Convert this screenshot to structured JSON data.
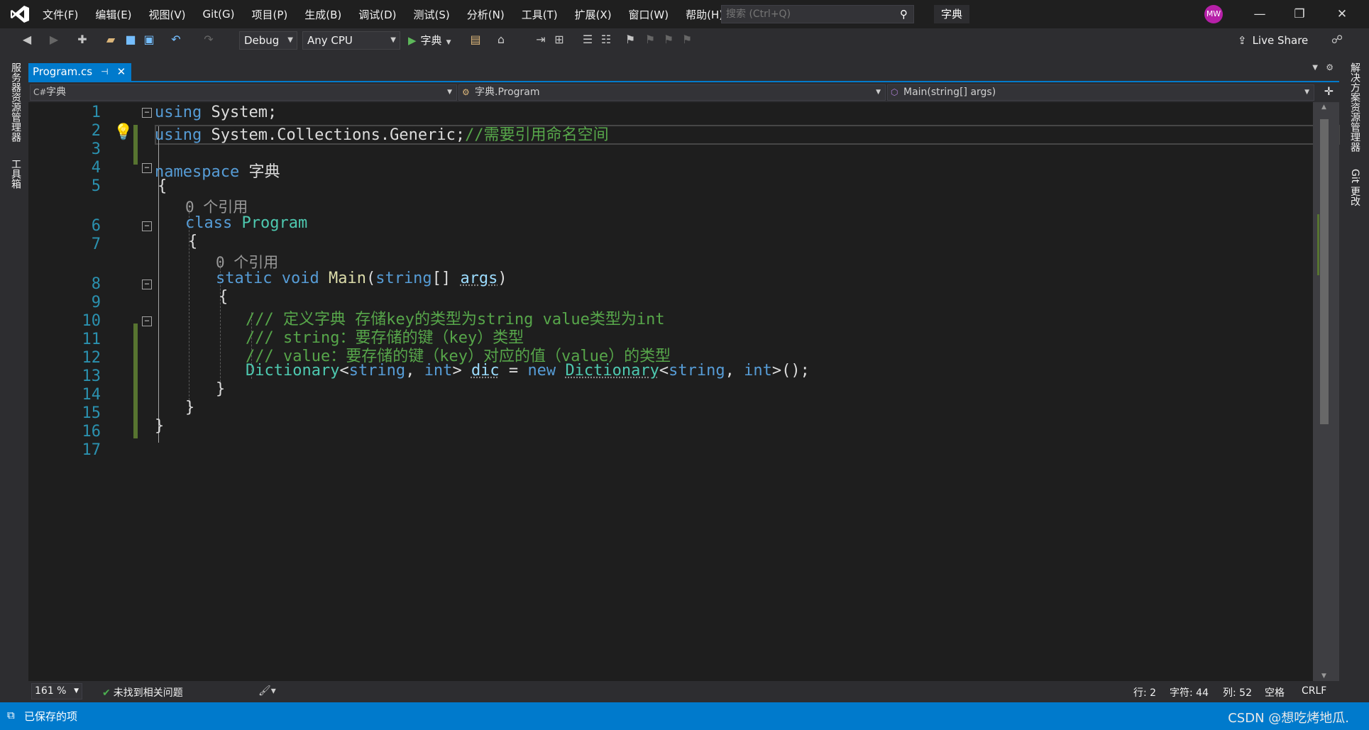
{
  "titlebar": {
    "menu": [
      "文件(F)",
      "编辑(E)",
      "视图(V)",
      "Git(G)",
      "项目(P)",
      "生成(B)",
      "调试(D)",
      "测试(S)",
      "分析(N)",
      "工具(T)",
      "扩展(X)",
      "窗口(W)",
      "帮助(H)"
    ],
    "search_placeholder": "搜索 (Ctrl+Q)",
    "solution_name": "字典",
    "avatar_initials": "MW"
  },
  "toolbar": {
    "config": "Debug",
    "platform": "Any CPU",
    "run_label": "字典",
    "live_share": "Live Share"
  },
  "side": {
    "left_tabs": [
      "服务器资源管理器",
      "工具箱"
    ],
    "right_tabs": [
      "解决方案资源管理器",
      "Git 更改"
    ]
  },
  "tab": {
    "name": "Program.cs",
    "pin": "⊣",
    "close": "✕"
  },
  "navbar": {
    "project": "字典",
    "type": "字典.Program",
    "member": "Main(string[] args)"
  },
  "editor": {
    "line_numbers": [
      "1",
      "2",
      "3",
      "4",
      "5",
      "6",
      "7",
      "8",
      "9",
      "10",
      "11",
      "12",
      "13",
      "14",
      "15",
      "16",
      "17"
    ],
    "codelens": [
      "0 个引用",
      "0 个引用"
    ],
    "lines": {
      "l1a": "using",
      "l1b": " System;",
      "l2a": "using",
      "l2b": " System.Collections.Generic;",
      "l2c": "//需要引用命名空间",
      "l4a": "namespace",
      "l4b": " 字典",
      "l5": "{",
      "l6a": "class",
      "l6b": "Program",
      "l7": "{",
      "l8a": "static",
      "l8b": "void",
      "l8c": "Main",
      "l8d": "(",
      "l8e": "string",
      "l8f": "[] ",
      "l8g": "args",
      "l8h": ")",
      "l9": "{",
      "l10": "/// 定义字典 存储key的类型为string value类型为int",
      "l11": "/// string：要存储的键（key）类型",
      "l12": "/// value：要存储的键（key）对应的值（value）的类型",
      "l13a": "Dictionary",
      "l13b": "<",
      "l13c": "string",
      "l13d": ", ",
      "l13e": "int",
      "l13f": "> ",
      "l13g": "dic",
      "l13h": " = ",
      "l13i": "new",
      "l13j": " ",
      "l13k": "Dictionary",
      "l13l": "<",
      "l13m": "string",
      "l13n": ", ",
      "l13o": "int",
      "l13p": ">();",
      "l14": "}",
      "l15": "}",
      "l16": "}"
    }
  },
  "editor_status": {
    "zoom": "161 %",
    "issues": "未找到相关问题",
    "line": "行: 2",
    "char": "字符: 44",
    "col": "列: 52",
    "whitespace": "空格",
    "eol": "CRLF"
  },
  "statusbar": {
    "saved": "已保存的项",
    "watermark": "CSDN @想吃烤地瓜."
  },
  "colors": {
    "accent": "#007acc",
    "keyword": "#569cd6",
    "type": "#4ec9b0",
    "comment": "#57a64a",
    "line_number": "#2b91af"
  }
}
